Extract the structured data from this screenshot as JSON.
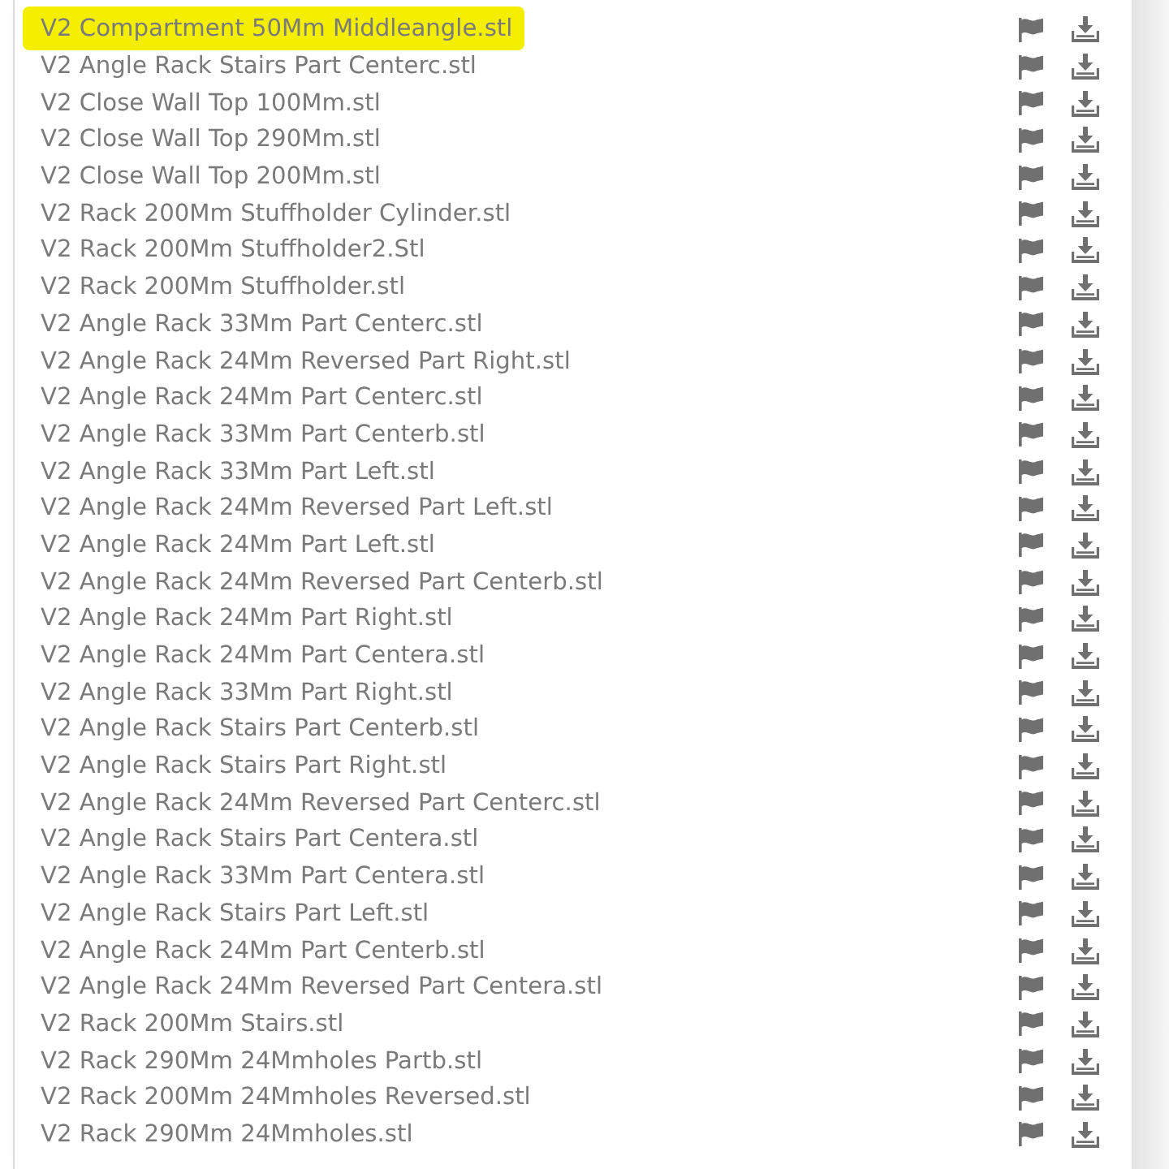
{
  "files": [
    {
      "name": "V2 Compartment 50Mm Middleangle.stl",
      "highlighted": true
    },
    {
      "name": "V2 Angle Rack Stairs Part Centerc.stl",
      "highlighted": false
    },
    {
      "name": "V2 Close Wall Top 100Mm.stl",
      "highlighted": false
    },
    {
      "name": "V2 Close Wall Top 290Mm.stl",
      "highlighted": false
    },
    {
      "name": "V2 Close Wall Top 200Mm.stl",
      "highlighted": false
    },
    {
      "name": "V2 Rack 200Mm Stuffholder Cylinder.stl",
      "highlighted": false
    },
    {
      "name": "V2 Rack 200Mm Stuffholder2.Stl",
      "highlighted": false
    },
    {
      "name": "V2 Rack 200Mm Stuffholder.stl",
      "highlighted": false
    },
    {
      "name": "V2 Angle Rack 33Mm Part Centerc.stl",
      "highlighted": false
    },
    {
      "name": "V2 Angle Rack 24Mm Reversed Part Right.stl",
      "highlighted": false
    },
    {
      "name": "V2 Angle Rack 24Mm Part Centerc.stl",
      "highlighted": false
    },
    {
      "name": "V2 Angle Rack 33Mm Part Centerb.stl",
      "highlighted": false
    },
    {
      "name": "V2 Angle Rack 33Mm Part Left.stl",
      "highlighted": false
    },
    {
      "name": "V2 Angle Rack 24Mm Reversed Part Left.stl",
      "highlighted": false
    },
    {
      "name": "V2 Angle Rack 24Mm Part Left.stl",
      "highlighted": false
    },
    {
      "name": "V2 Angle Rack 24Mm Reversed Part Centerb.stl",
      "highlighted": false
    },
    {
      "name": "V2 Angle Rack 24Mm Part Right.stl",
      "highlighted": false
    },
    {
      "name": "V2 Angle Rack 24Mm Part Centera.stl",
      "highlighted": false
    },
    {
      "name": "V2 Angle Rack 33Mm Part Right.stl",
      "highlighted": false
    },
    {
      "name": "V2 Angle Rack Stairs Part Centerb.stl",
      "highlighted": false
    },
    {
      "name": "V2 Angle Rack Stairs Part Right.stl",
      "highlighted": false
    },
    {
      "name": "V2 Angle Rack 24Mm Reversed Part Centerc.stl",
      "highlighted": false
    },
    {
      "name": "V2 Angle Rack Stairs Part Centera.stl",
      "highlighted": false
    },
    {
      "name": "V2 Angle Rack 33Mm Part Centera.stl",
      "highlighted": false
    },
    {
      "name": "V2 Angle Rack Stairs Part Left.stl",
      "highlighted": false
    },
    {
      "name": "V2 Angle Rack 24Mm Part Centerb.stl",
      "highlighted": false
    },
    {
      "name": "V2 Angle Rack 24Mm Reversed Part Centera.stl",
      "highlighted": false
    },
    {
      "name": "V2 Rack 200Mm Stairs.stl",
      "highlighted": false
    },
    {
      "name": "V2 Rack 290Mm 24Mmholes Partb.stl",
      "highlighted": false
    },
    {
      "name": "V2 Rack 200Mm 24Mmholes Reversed.stl",
      "highlighted": false
    },
    {
      "name": "V2 Rack 290Mm 24Mmholes.stl",
      "highlighted": false
    }
  ]
}
